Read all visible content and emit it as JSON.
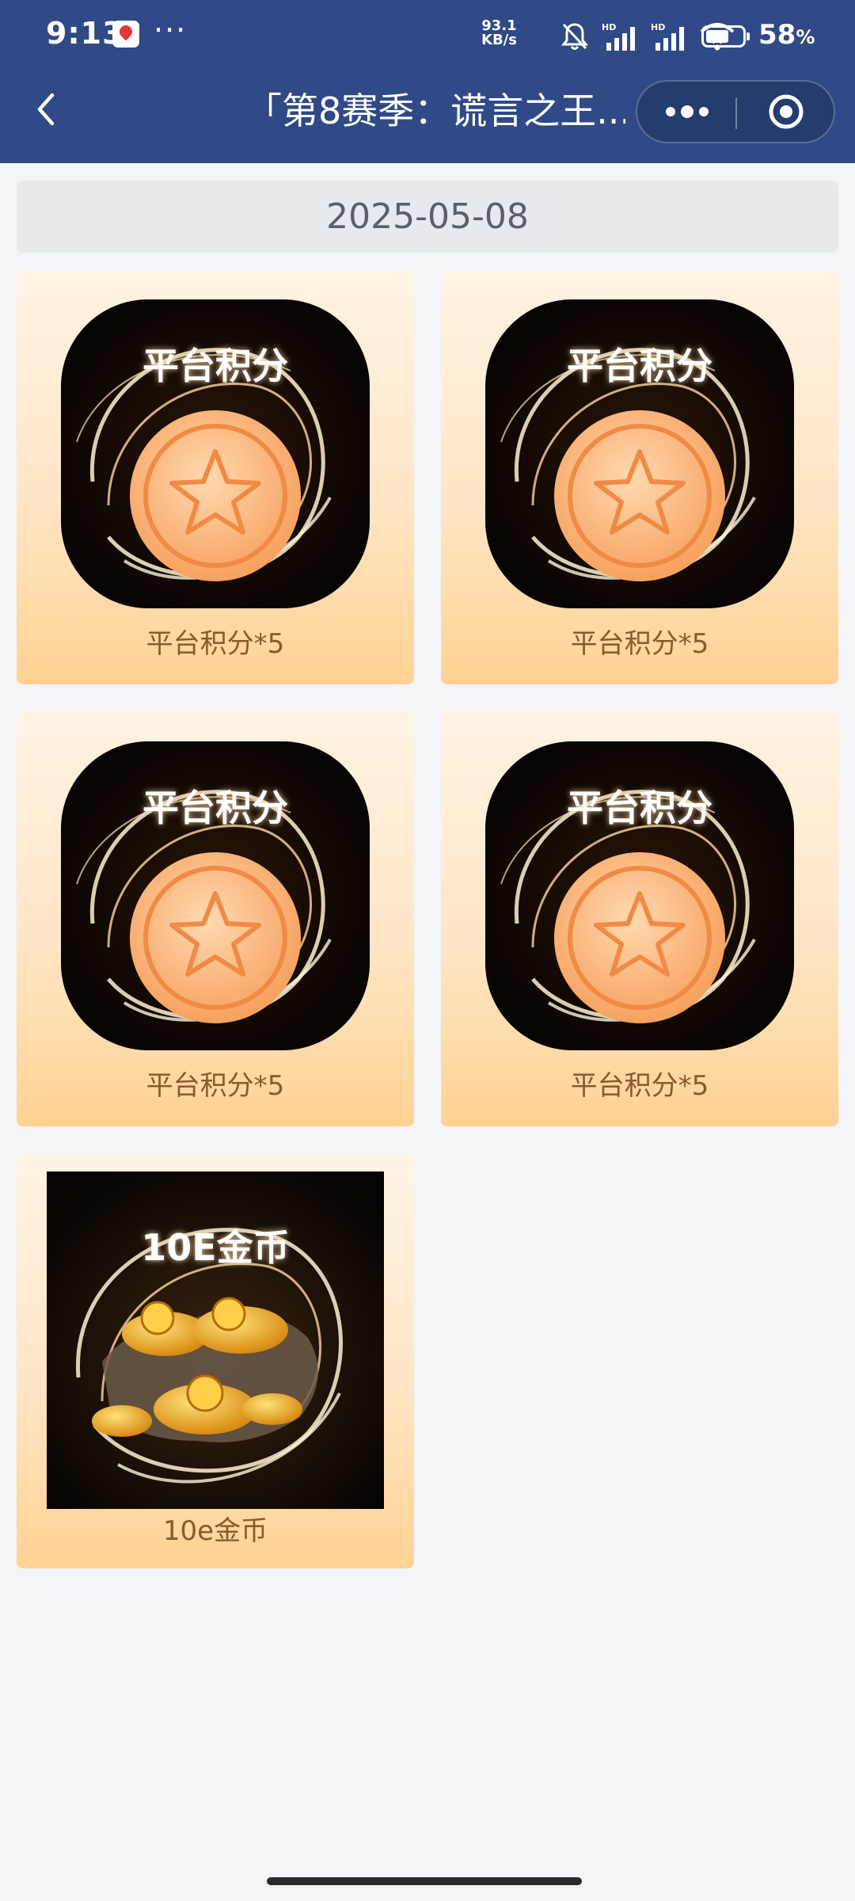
{
  "status_bar": {
    "time": "9:13",
    "more": "···",
    "net_speed_value": "93.1",
    "net_speed_unit": "KB/s",
    "battery_percent": "58",
    "battery_unit": "%"
  },
  "nav": {
    "title": "「第8赛季：谎言之王..."
  },
  "date": "2025-05-08",
  "rewards": [
    {
      "art_label": "平台积分",
      "name": "平台积分*5"
    },
    {
      "art_label": "平台积分",
      "name": "平台积分*5"
    },
    {
      "art_label": "平台积分",
      "name": "平台积分*5"
    },
    {
      "art_label": "平台积分",
      "name": "平台积分*5"
    },
    {
      "art_label": "10E金币",
      "name": "10e金币"
    }
  ],
  "colors": {
    "header_bg": "#2f4a86",
    "page_bg": "#f3f4f7",
    "card_gradient_top": "#fff3e3",
    "card_gradient_bottom": "#ffd293",
    "reward_text": "#8a5a2e",
    "date_bar_bg": "#e7e9ee"
  }
}
